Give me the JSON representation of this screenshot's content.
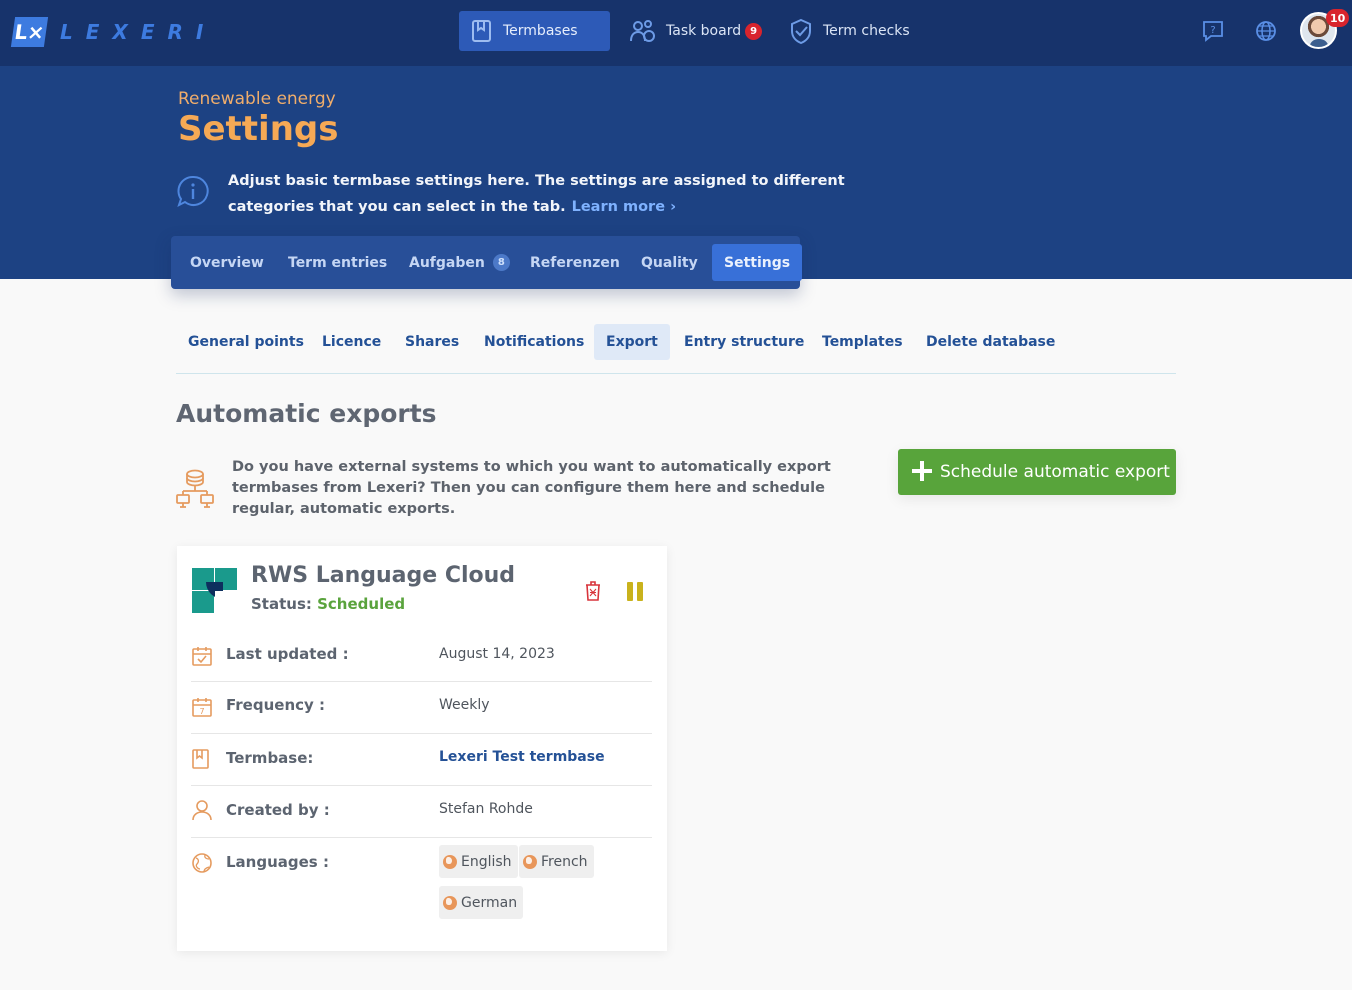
{
  "app": {
    "logo_text": "LEXERI",
    "logo_mark": "L×"
  },
  "topnav": {
    "items": [
      {
        "label": "Termbases",
        "icon": "book-icon",
        "active": true
      },
      {
        "label": "Task board",
        "icon": "people-icon",
        "badge": "9"
      },
      {
        "label": "Term checks",
        "icon": "shield-check-icon"
      }
    ],
    "help_icon": "help-icon",
    "language_icon": "globe-icon",
    "avatar_badge": "10"
  },
  "header": {
    "subtitle": "Renewable energy",
    "title": "Settings",
    "info_text": "Adjust basic termbase settings here. The settings are assigned to different categories that you can select in the tab.",
    "learn_more": "Learn more ›"
  },
  "tabs": [
    {
      "label": "Overview"
    },
    {
      "label": "Term entries"
    },
    {
      "label": "Aufgaben",
      "count": "8"
    },
    {
      "label": "Referenzen"
    },
    {
      "label": "Quality"
    },
    {
      "label": "Settings",
      "active": true
    }
  ],
  "subtabs": [
    {
      "label": "General points"
    },
    {
      "label": "Licence"
    },
    {
      "label": "Shares"
    },
    {
      "label": "Notifications"
    },
    {
      "label": "Export",
      "active": true
    },
    {
      "label": "Entry structure"
    },
    {
      "label": "Templates"
    },
    {
      "label": "Delete database"
    }
  ],
  "section": {
    "title": "Automatic exports",
    "description": "Do you have external systems to which you want to automatically export termbases from Lexeri? Then you can configure them here and schedule regular, automatic exports.",
    "schedule_button": "Schedule automatic export"
  },
  "card": {
    "title": "RWS Language Cloud",
    "status_label": "Status:",
    "status_value": "Scheduled",
    "rows": [
      {
        "label": "Last updated :",
        "value": "August 14, 2023",
        "icon": "calendar-check-icon"
      },
      {
        "label": "Frequency :",
        "value": "Weekly",
        "icon": "calendar-icon"
      },
      {
        "label": "Termbase:",
        "value": "Lexeri Test termbase",
        "icon": "book-icon",
        "link": true
      },
      {
        "label": "Created by :",
        "value": "Stefan Rohde",
        "icon": "user-icon"
      },
      {
        "label": "Languages :",
        "icon": "globe-icon"
      }
    ],
    "languages": [
      "English",
      "French",
      "German"
    ]
  },
  "colors": {
    "nav_bg": "#17336b",
    "header_bg": "#1d4283",
    "accent_orange": "#f6a955",
    "primary_blue": "#245196",
    "green": "#58a43b",
    "status_green": "#5aa33d"
  }
}
